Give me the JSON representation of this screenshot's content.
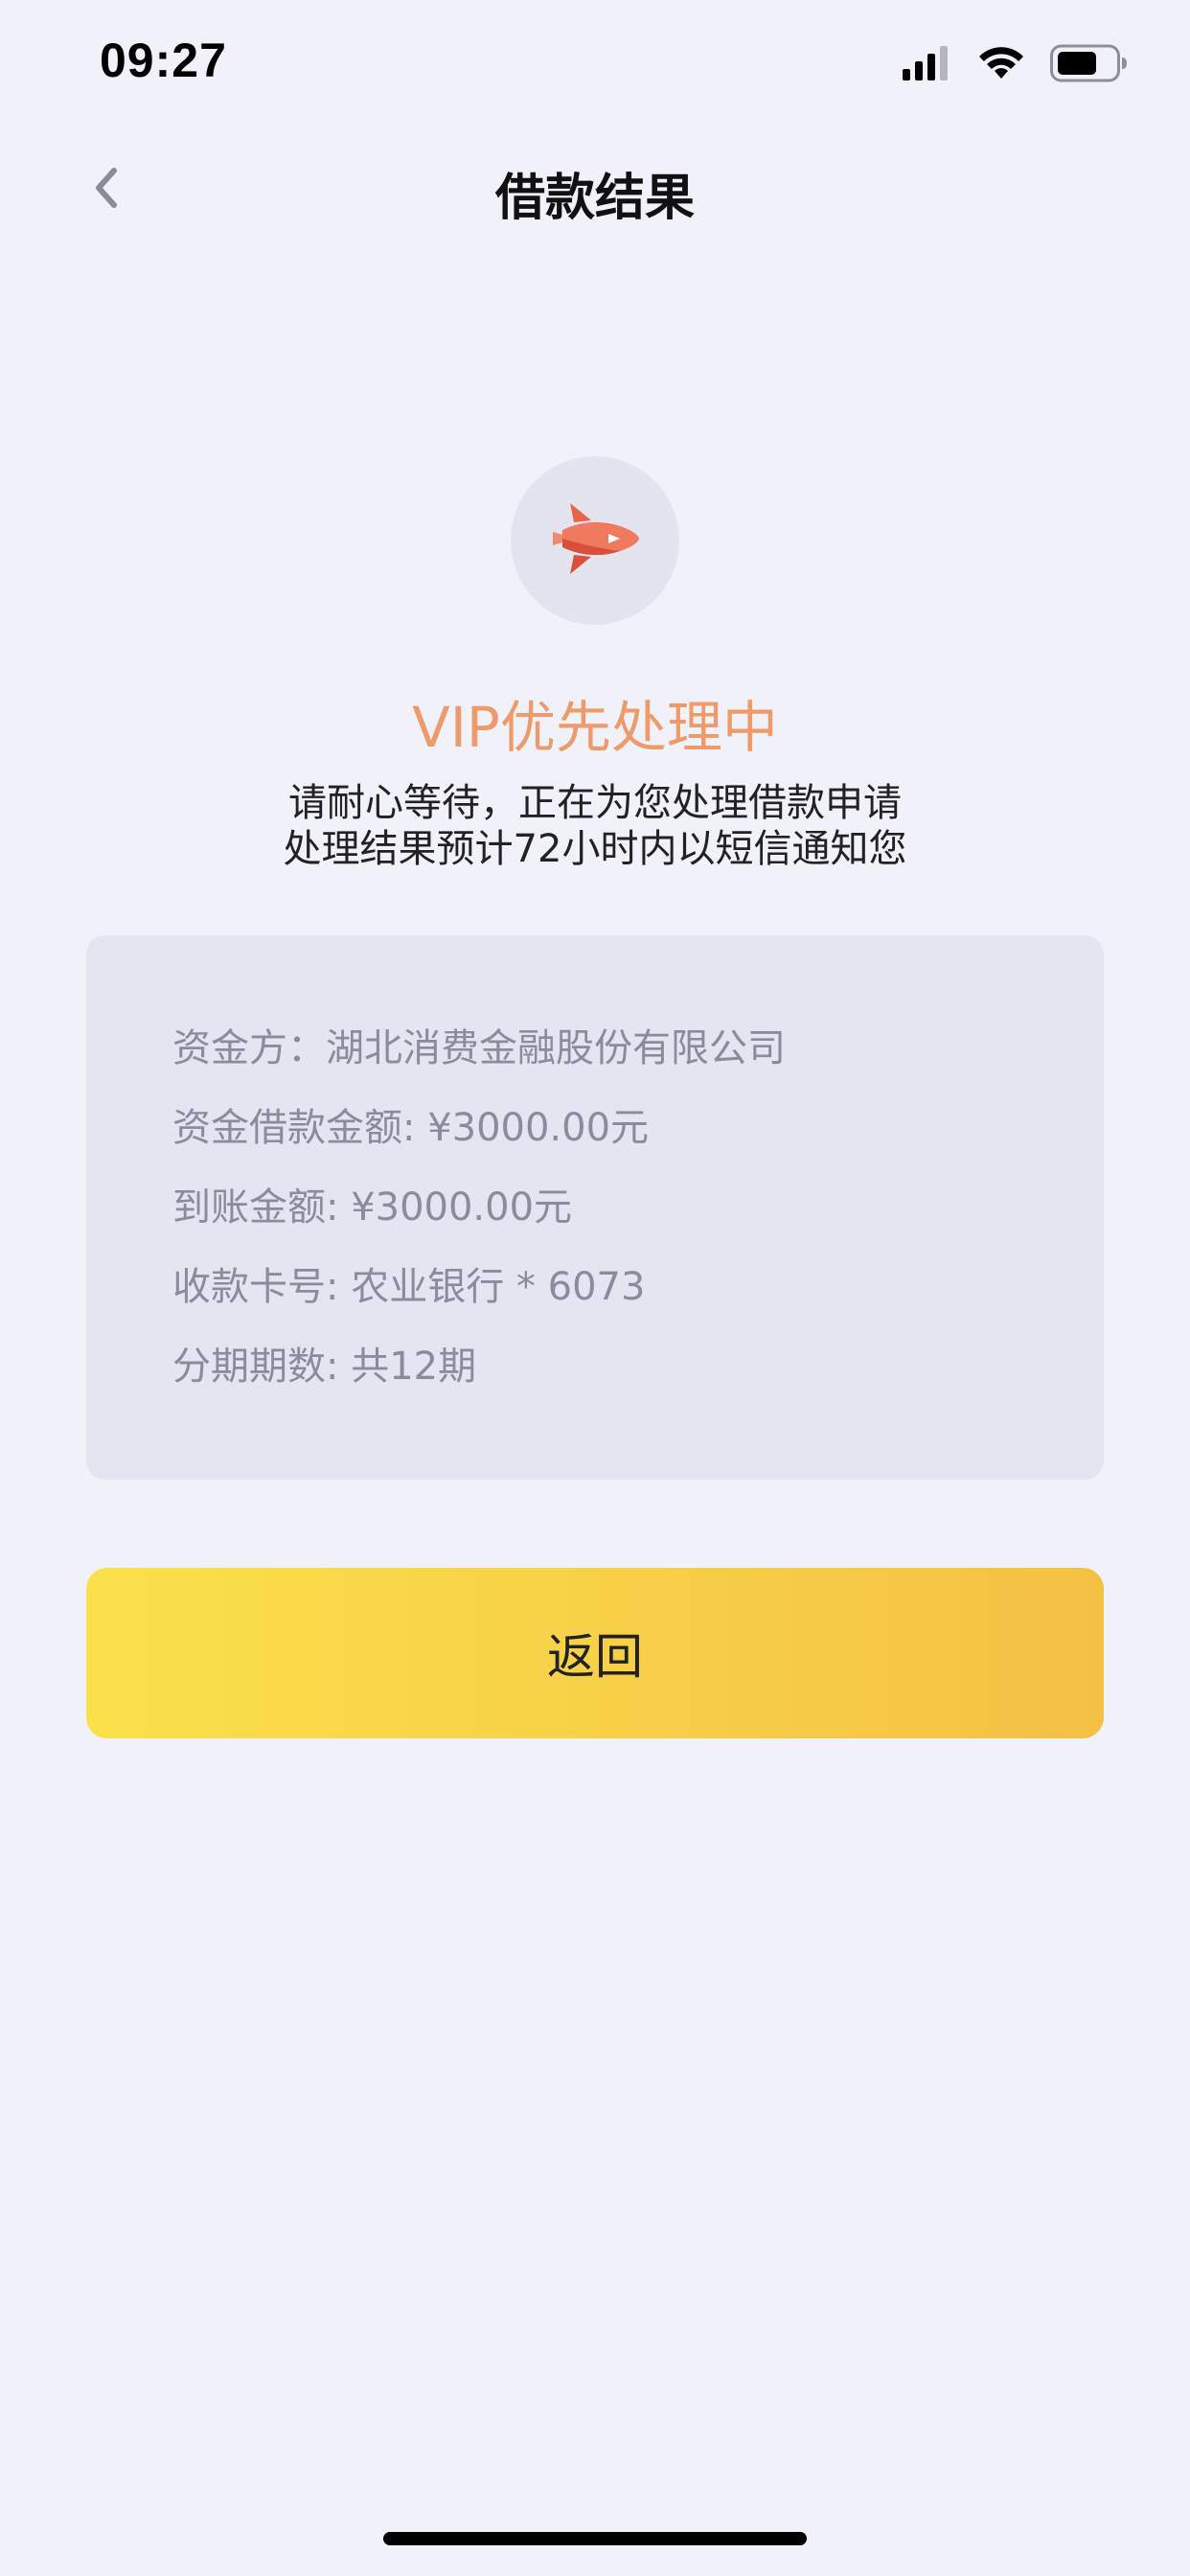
{
  "status_bar": {
    "time": "09:27",
    "icons": [
      "signal-icon",
      "wifi-icon",
      "battery-icon"
    ]
  },
  "header": {
    "title": "借款结果",
    "back_icon": "chevron-left-icon"
  },
  "status": {
    "icon": "rocket-icon",
    "heading": "VIP优先处理中",
    "description_line1": "请耐心等待，正在为您处理借款申请",
    "description_line2": "处理结果预计72小时内以短信通知您"
  },
  "details": {
    "funder": "资金方：湖北消费金融股份有限公司",
    "loan_amount": "资金借款金额: ¥3000.00元",
    "received_amount": "到账金额: ¥3000.00元",
    "card": "收款卡号: 农业银行 * 6073",
    "installments": "分期期数: 共12期"
  },
  "actions": {
    "return_label": "返回"
  },
  "colors": {
    "background": "#f1f1f9",
    "heading_accent": "#ee9a6a",
    "button_gradient_start": "#fae14a",
    "button_gradient_end": "#f5c143",
    "card_background": "#e4e5f0"
  }
}
